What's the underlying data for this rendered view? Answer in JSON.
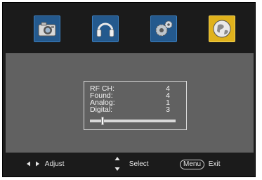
{
  "tabs": [
    {
      "id": "picture",
      "icon": "camera-icon",
      "active": false
    },
    {
      "id": "sound",
      "icon": "headphones-icon",
      "active": false
    },
    {
      "id": "setup",
      "icon": "gear-icon",
      "active": false
    },
    {
      "id": "channel",
      "icon": "globe-icon",
      "active": true
    }
  ],
  "scan": {
    "rows": [
      {
        "label": "RF  CH:",
        "value": "4"
      },
      {
        "label": "Found:",
        "value": "4"
      },
      {
        "label": "Analog:",
        "value": "1"
      },
      {
        "label": "Digital:",
        "value": "3"
      }
    ],
    "progress": 0.15
  },
  "footer": {
    "adjust_label": "Adjust",
    "select_label": "Select",
    "menu_key": "Menu",
    "exit_label": "Exit"
  },
  "colors": {
    "tab_normal": "#24598d",
    "tab_active": "#e0b21c",
    "panel_bg": "#616161"
  }
}
